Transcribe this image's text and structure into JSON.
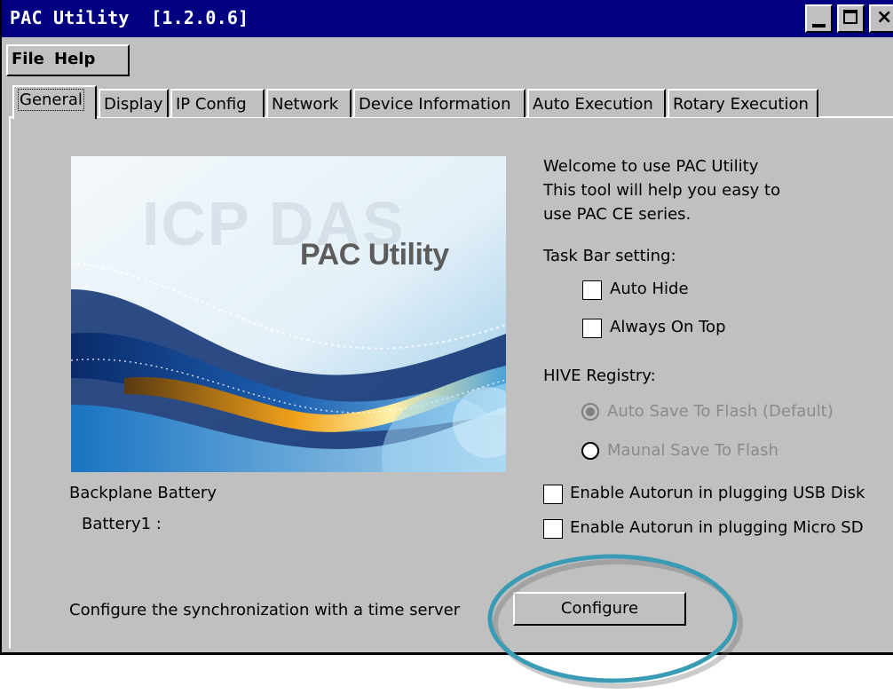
{
  "window": {
    "title": "PAC Utility  [1.2.0.6]",
    "controls": {
      "minimize": "minimize-icon",
      "maximize": "maximize-icon",
      "close": "close-icon",
      "close_glyph": "×"
    }
  },
  "menu": {
    "items": [
      "File",
      "Help"
    ]
  },
  "tabs": [
    "General",
    "Display",
    "IP Config",
    "Network",
    "Device Information",
    "Auto Execution",
    "Rotary Execution"
  ],
  "active_tab": "General",
  "hero": {
    "watermark": "ICP DAS",
    "title": "PAC Utility"
  },
  "welcome": {
    "line1": "Welcome to use PAC Utility",
    "line2": "This tool will help you easy to",
    "line3": "use PAC CE series."
  },
  "taskbar": {
    "heading": "Task Bar setting:",
    "auto_hide": {
      "label": "Auto Hide",
      "checked": false
    },
    "always_on_top": {
      "label": "Always On Top",
      "checked": false
    }
  },
  "hive": {
    "heading": "HIVE Registry:",
    "options": [
      {
        "label": "Auto Save To Flash (Default)",
        "selected": true,
        "enabled": false
      },
      {
        "label": "Maunal Save To Flash",
        "selected": false,
        "enabled": false
      }
    ]
  },
  "autorun": {
    "usb": {
      "label": "Enable Autorun in plugging USB Disk",
      "checked": false
    },
    "sd": {
      "label": "Enable Autorun in plugging Micro SD",
      "checked": false
    }
  },
  "battery": {
    "heading": "Backplane Battery",
    "battery1": "Battery1 :"
  },
  "time_sync": {
    "label": "Configure the synchronization with a time server",
    "button": "Configure"
  },
  "colors": {
    "titlebar": "#000080",
    "face": "#c0c0c0",
    "annotation": "#3a9bb5"
  }
}
